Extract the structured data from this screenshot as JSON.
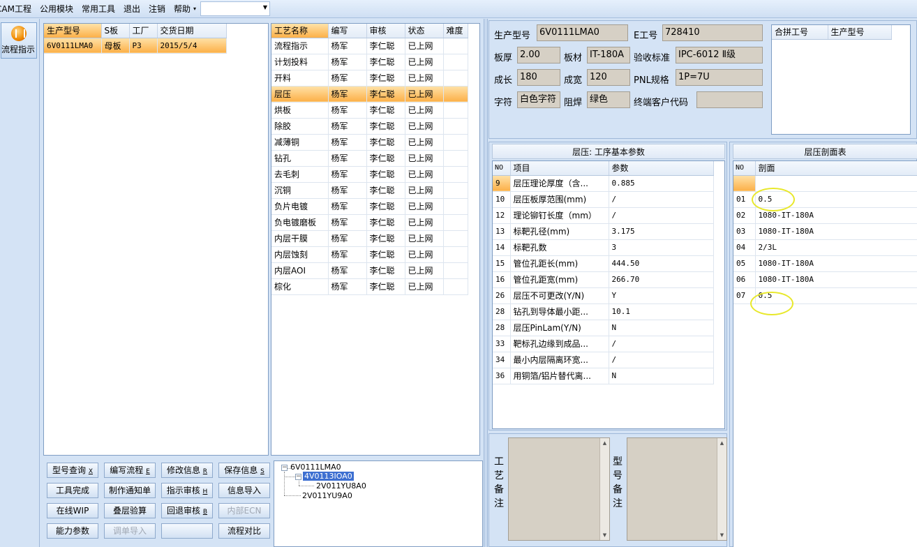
{
  "menu": {
    "items": [
      "CAM工程",
      "公用模块",
      "常用工具",
      "退出",
      "注销",
      "帮助"
    ],
    "dropdown_arrow": "▾",
    "combo_value": ""
  },
  "toolbar": {
    "flow_label": "流程指示",
    "flow_icon": "flow-icon"
  },
  "products": {
    "columns": [
      "生产型号",
      "S板",
      "工厂",
      "交货日期"
    ],
    "rows": [
      {
        "model": "6V0111LMA0",
        "board": "母板",
        "factory": "P3",
        "date": "2015/5/4"
      }
    ]
  },
  "process": {
    "columns": [
      "工艺名称",
      "编写",
      "审核",
      "状态",
      "难度"
    ],
    "rows": [
      {
        "name": "流程指示",
        "writer": "杨军",
        "reviewer": "李仁聪",
        "status": "已上网"
      },
      {
        "name": "计划投料",
        "writer": "杨军",
        "reviewer": "李仁聪",
        "status": "已上网"
      },
      {
        "name": "开料",
        "writer": "杨军",
        "reviewer": "李仁聪",
        "status": "已上网"
      },
      {
        "name": "层压",
        "writer": "杨军",
        "reviewer": "李仁聪",
        "status": "已上网"
      },
      {
        "name": "烘板",
        "writer": "杨军",
        "reviewer": "李仁聪",
        "status": "已上网"
      },
      {
        "name": "除胶",
        "writer": "杨军",
        "reviewer": "李仁聪",
        "status": "已上网"
      },
      {
        "name": "减薄铜",
        "writer": "杨军",
        "reviewer": "李仁聪",
        "status": "已上网"
      },
      {
        "name": "钻孔",
        "writer": "杨军",
        "reviewer": "李仁聪",
        "status": "已上网"
      },
      {
        "name": "去毛刺",
        "writer": "杨军",
        "reviewer": "李仁聪",
        "status": "已上网"
      },
      {
        "name": "沉铜",
        "writer": "杨军",
        "reviewer": "李仁聪",
        "status": "已上网"
      },
      {
        "name": "负片电镀",
        "writer": "杨军",
        "reviewer": "李仁聪",
        "status": "已上网"
      },
      {
        "name": "负电镀磨板",
        "writer": "杨军",
        "reviewer": "李仁聪",
        "status": "已上网"
      },
      {
        "name": "内层干膜",
        "writer": "杨军",
        "reviewer": "李仁聪",
        "status": "已上网"
      },
      {
        "name": "内层蚀刻",
        "writer": "杨军",
        "reviewer": "李仁聪",
        "status": "已上网"
      },
      {
        "name": "内层AOI",
        "writer": "杨军",
        "reviewer": "李仁聪",
        "status": "已上网"
      },
      {
        "name": "棕化",
        "writer": "杨军",
        "reviewer": "李仁聪",
        "status": "已上网"
      }
    ]
  },
  "buttons": [
    {
      "label": "型号查询",
      "key": "X",
      "enabled": true
    },
    {
      "label": "编写流程",
      "key": "E",
      "enabled": true
    },
    {
      "label": "修改信息",
      "key": "R",
      "enabled": true
    },
    {
      "label": "保存信息",
      "key": "S",
      "enabled": true
    },
    {
      "label": "工具完成",
      "key": "",
      "enabled": true
    },
    {
      "label": "制作通知单",
      "key": "",
      "enabled": true
    },
    {
      "label": "指示审核",
      "key": "H",
      "enabled": true
    },
    {
      "label": "信息导入",
      "key": "",
      "enabled": true
    },
    {
      "label": "在线WIP",
      "key": "",
      "enabled": true
    },
    {
      "label": "叠层验算",
      "key": "",
      "enabled": true
    },
    {
      "label": "回退审核",
      "key": "B",
      "enabled": true
    },
    {
      "label": "内部ECN",
      "key": "",
      "enabled": false
    },
    {
      "label": "能力参数",
      "key": "",
      "enabled": true
    },
    {
      "label": "调单导入",
      "key": "",
      "enabled": false
    },
    {
      "label": "",
      "key": "",
      "enabled": true
    },
    {
      "label": "流程对比",
      "key": "",
      "enabled": true
    }
  ],
  "tree": {
    "root": "6V0111LMA0",
    "child": "4V0113IOA0",
    "grandchild": "2V011YU8A0",
    "sibling": "2V011YU9A0",
    "collapse_glyph": "−"
  },
  "info": {
    "model_label": "生产型号",
    "model_value": "6V0111LMA0",
    "eno_label": "E工号",
    "eno_value": "728410",
    "thickness_label": "板厚",
    "thickness_value": "2.00",
    "material_label": "板材",
    "material_value": "IT-180A",
    "standard_label": "验收标准",
    "standard_value": "IPC-6012 Ⅱ级",
    "length_label": "成长",
    "length_value": "180",
    "width_label": "成宽",
    "width_value": "120",
    "pnl_label": "PNL规格",
    "pnl_value": "1P=7U",
    "silk_label": "字符",
    "silk_value": "白色字符",
    "mask_label": "阻焊",
    "mask_value": "绿色",
    "customer_label": "终端客户代码",
    "customer_value": "",
    "combine_columns": [
      "合拼工号",
      "生产型号"
    ]
  },
  "params": {
    "title": "层压: 工序基本参数",
    "columns": [
      "NO",
      "项目",
      "参数"
    ],
    "rows": [
      {
        "no": "9",
        "item": "层压理论厚度（含...",
        "value": "0.885"
      },
      {
        "no": "10",
        "item": "层压板厚范围(mm)",
        "value": "/"
      },
      {
        "no": "12",
        "item": "理论铆钉长度（mm）",
        "value": "/"
      },
      {
        "no": "13",
        "item": "标靶孔径(mm)",
        "value": "3.175"
      },
      {
        "no": "14",
        "item": "标靶孔数",
        "value": "3"
      },
      {
        "no": "15",
        "item": "管位孔距长(mm)",
        "value": "444.50"
      },
      {
        "no": "16",
        "item": "管位孔距宽(mm)",
        "value": "266.70"
      },
      {
        "no": "26",
        "item": "层压不可更改(Y/N)",
        "value": "Y"
      },
      {
        "no": "28",
        "item": "钻孔到导体最小距...",
        "value": "10.1"
      },
      {
        "no": "28",
        "item": "层压PinLam(Y/N)",
        "value": "N"
      },
      {
        "no": "33",
        "item": "靶标孔边缘到成品...",
        "value": "/"
      },
      {
        "no": "34",
        "item": "最小内层隔离环宽...",
        "value": "/"
      },
      {
        "no": "36",
        "item": "用铜箔/铝片替代离...",
        "value": "N"
      }
    ]
  },
  "section": {
    "title": "层压剖面表",
    "columns": [
      "NO",
      "剖面"
    ],
    "rows": [
      {
        "no": "",
        "value": ""
      },
      {
        "no": "01",
        "value": "0.5"
      },
      {
        "no": "02",
        "value": "1080-IT-180A"
      },
      {
        "no": "03",
        "value": "1080-IT-180A"
      },
      {
        "no": "04",
        "value": "2/3L"
      },
      {
        "no": "05",
        "value": "1080-IT-180A"
      },
      {
        "no": "06",
        "value": "1080-IT-180A"
      },
      {
        "no": "07",
        "value": "0.5"
      }
    ]
  },
  "remarks": {
    "process_label": "工艺备注",
    "model_label": "型号备注",
    "process_text": "",
    "model_text": ""
  },
  "colors": {
    "selection": "#fcb048",
    "highlight_circle": "#e8e82a",
    "tree_select": "#3d6fd1"
  }
}
